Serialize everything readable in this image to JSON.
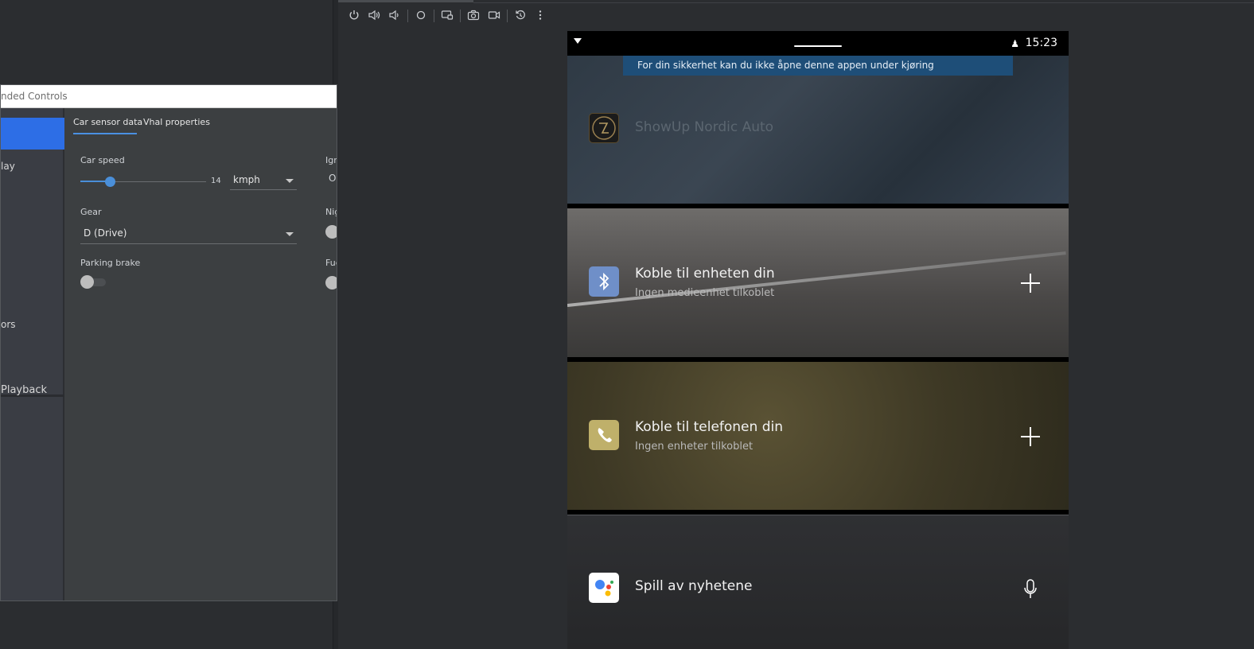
{
  "extended_controls": {
    "title": "nded Controls",
    "sidebar": {
      "items": [
        {
          "label": "lay"
        },
        {
          "label": "ors"
        },
        {
          "label": "Playback"
        }
      ]
    },
    "tabs": [
      {
        "label": "Car sensor data"
      },
      {
        "label": "Vhal properties"
      }
    ],
    "car_speed": {
      "label": "Car speed",
      "value": "14",
      "unit": "kmph",
      "slider_fraction": 0.14
    },
    "gear": {
      "label": "Gear",
      "value": "D (Drive)"
    },
    "parking_brake": {
      "label": "Parking brake"
    },
    "right_column": {
      "ignition_label": "Ign",
      "ignition_value": "Or",
      "night_label": "Nig",
      "fuel_label": "Fue"
    }
  },
  "device": {
    "status_bar": {
      "time": "15:23",
      "user_icon": "person-car-icon"
    },
    "safety_banner": "For din sikkerhet kan du ikke åpne denne appen under kjøring",
    "cards": [
      {
        "title": "ShowUp Nordic Auto",
        "icon": "showup-logo-icon"
      },
      {
        "title": "Koble til enheten din",
        "subtitle": "Ingen medieenhet tilkoblet",
        "icon": "bluetooth-icon"
      },
      {
        "title": "Koble til telefonen din",
        "subtitle": "Ingen enheter tilkoblet",
        "icon": "phone-icon"
      },
      {
        "title": "Spill av nyhetene",
        "icon": "google-assistant-icon"
      }
    ]
  },
  "colors": {
    "accent_blue": "#2d6ee6",
    "slider_blue": "#4a8fd9",
    "banner_blue": "#1e4e78",
    "bluetooth_icon_bg": "#6f8fc8",
    "phone_icon_bg": "#bfb06a"
  }
}
